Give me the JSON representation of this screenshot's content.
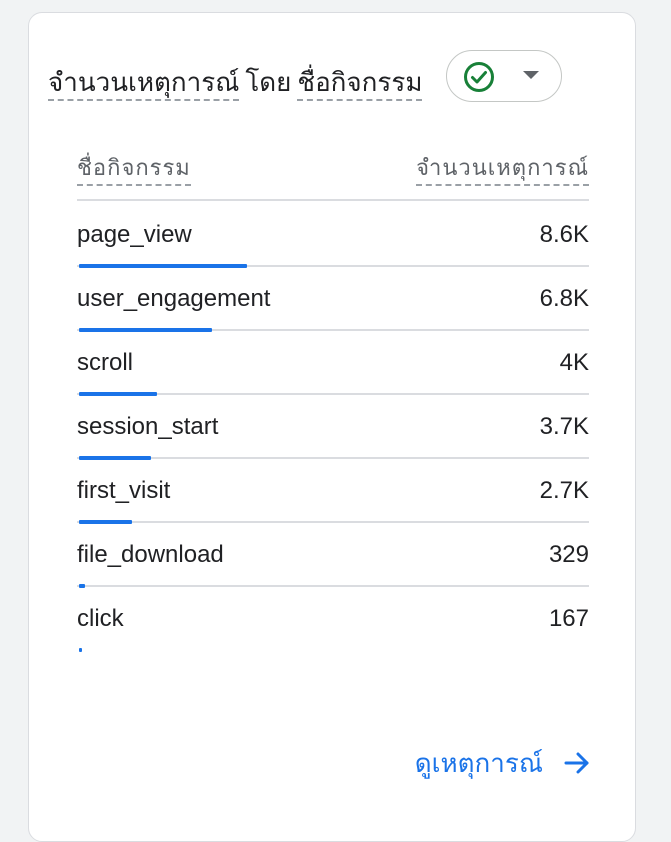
{
  "card": {
    "title_metric": "จำนวนเหตุการณ์",
    "title_by": "โดย",
    "title_dimension": "ชื่อกิจกรรม",
    "compare_icon": "check-circle-icon",
    "dropdown_icon": "caret-down-icon"
  },
  "table": {
    "col_name": "ชื่อกิจกรรม",
    "col_count": "จำนวนเหตุการณ์",
    "max_value": 8600,
    "rows": [
      {
        "name": "page_view",
        "value_label": "8.6K",
        "value": 8600
      },
      {
        "name": "user_engagement",
        "value_label": "6.8K",
        "value": 6800
      },
      {
        "name": "scroll",
        "value_label": "4K",
        "value": 4000
      },
      {
        "name": "session_start",
        "value_label": "3.7K",
        "value": 3700
      },
      {
        "name": "first_visit",
        "value_label": "2.7K",
        "value": 2700
      },
      {
        "name": "file_download",
        "value_label": "329",
        "value": 329
      },
      {
        "name": "click",
        "value_label": "167",
        "value": 167
      }
    ]
  },
  "footer": {
    "view_link": "ดูเหตุการณ์",
    "arrow_icon": "arrow-right-icon"
  },
  "colors": {
    "accent": "#1a73e8",
    "check": "#188038"
  }
}
